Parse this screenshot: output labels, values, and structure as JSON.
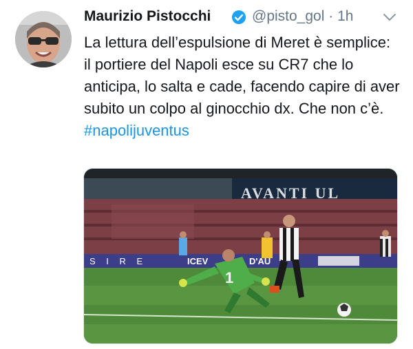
{
  "tweet": {
    "author_name": "Maurizio Pistocchi",
    "handle": "@pisto_gol",
    "separator": "·",
    "time": "1h",
    "text": "La lettura dell’espulsione di Meret è semplice: il portiere del Napoli esce su CR7 che lo anticipa, lo salta e cade, facendo capire di aver subito un colpo al ginocchio dx.  Che non c’è.",
    "hashtag": "#napolijuventus"
  },
  "media": {
    "stadium_banner": "AVANTI UL",
    "ad_board": "S I R E",
    "ad_board_2": "ICEV",
    "ad_board_3": "D'AU",
    "keeper_number": "1"
  },
  "icons": {
    "verified": "verified-badge-icon",
    "menu": "chevron-down-icon"
  },
  "colors": {
    "link": "#1b95e0",
    "verified": "#1da1f2",
    "secondary_text": "#657786"
  }
}
